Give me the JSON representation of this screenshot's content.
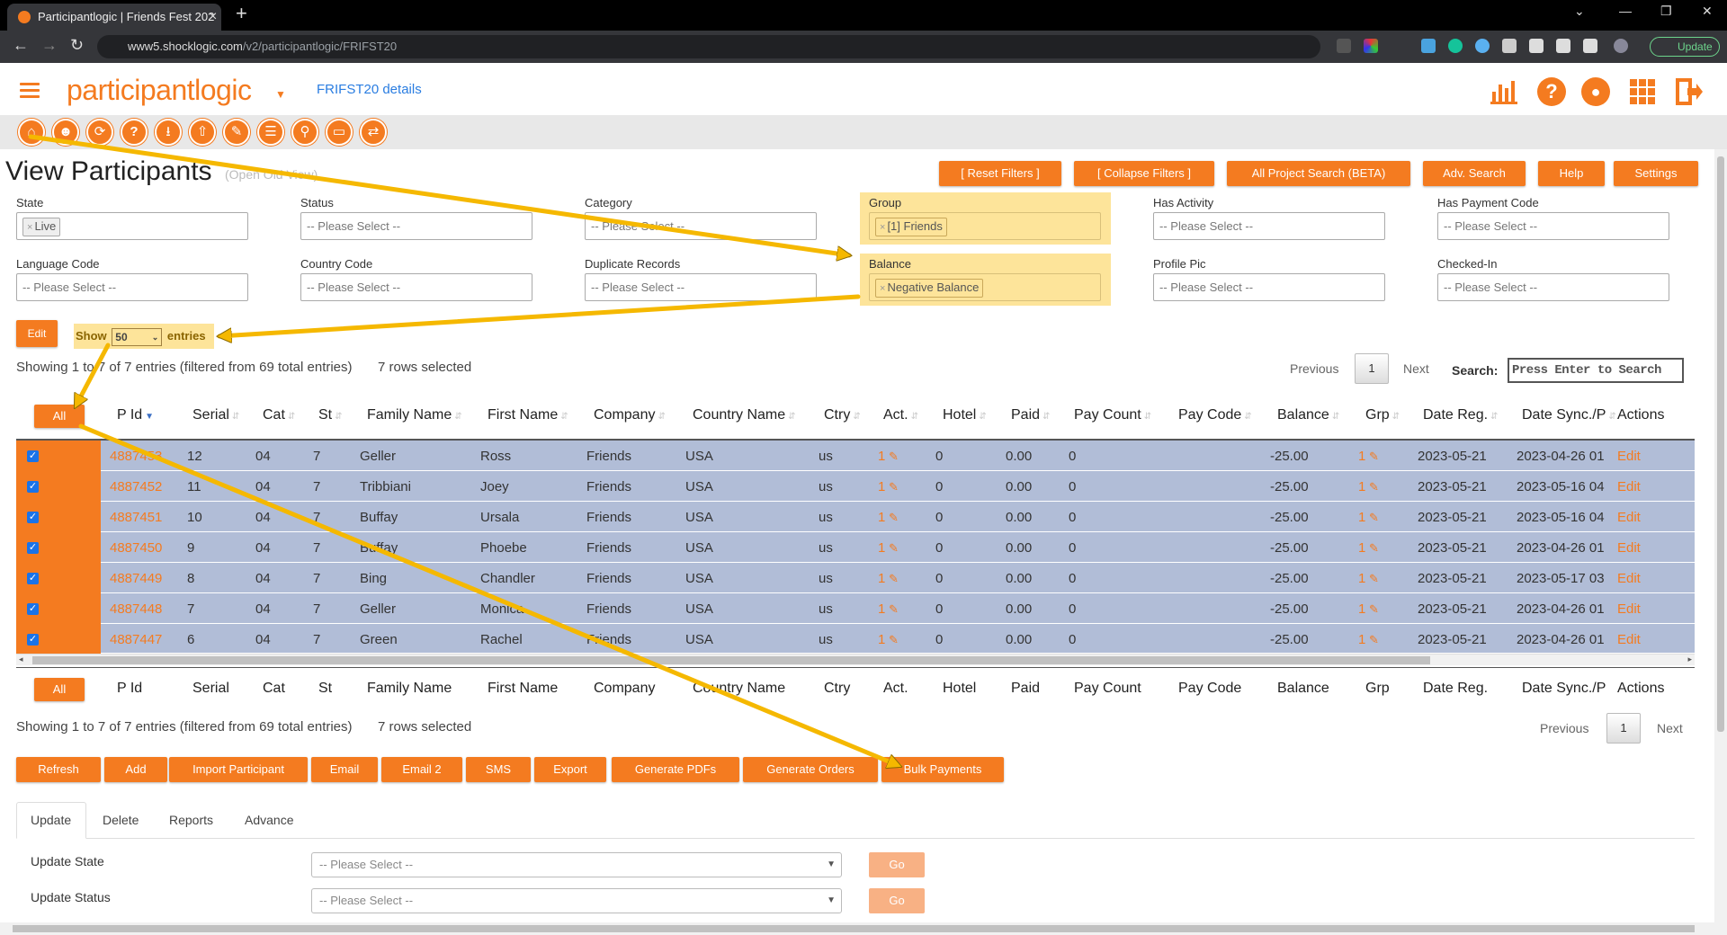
{
  "browser": {
    "tab_title": "Participantlogic | Friends Fest 202",
    "url_host": "www5.shocklogic.com",
    "url_path": "/v2/participantlogic/FRIFST20",
    "update_label": "Update"
  },
  "header": {
    "logo_text": "participantlogic",
    "project_link": "FRIFST20 details"
  },
  "page": {
    "title": "View Participants",
    "subtitle": "(Open Old View)"
  },
  "top_buttons": [
    "[ Reset Filters ]",
    "[ Collapse Filters ]",
    "All Project Search (BETA)",
    "Adv. Search",
    "Help",
    "Settings"
  ],
  "filters": [
    {
      "label": "State",
      "chip": "Live",
      "placeholder": ""
    },
    {
      "label": "Status",
      "chip": "",
      "placeholder": "-- Please Select --"
    },
    {
      "label": "Category",
      "chip": "",
      "placeholder": "-- Please Select --"
    },
    {
      "label": "Group",
      "chip": "[1] Friends",
      "placeholder": ""
    },
    {
      "label": "Has Activity",
      "chip": "",
      "placeholder": "-- Please Select --"
    },
    {
      "label": "Has Payment Code",
      "chip": "",
      "placeholder": "-- Please Select --"
    },
    {
      "label": "Language Code",
      "chip": "",
      "placeholder": "-- Please Select --"
    },
    {
      "label": "Country Code",
      "chip": "",
      "placeholder": "-- Please Select --"
    },
    {
      "label": "Duplicate Records",
      "chip": "",
      "placeholder": "-- Please Select --"
    },
    {
      "label": "Balance",
      "chip": "Negative Balance",
      "placeholder": ""
    },
    {
      "label": "Profile Pic",
      "chip": "",
      "placeholder": "-- Please Select --"
    },
    {
      "label": "Checked-In",
      "chip": "",
      "placeholder": "-- Please Select --"
    }
  ],
  "edit_label": "Edit",
  "show_entries": {
    "show": "Show",
    "value": "50",
    "entries": "entries"
  },
  "info_top": "Showing 1 to 7 of 7 entries (filtered from 69 total entries)",
  "rows_selected": "7 rows selected",
  "pager": {
    "previous": "Previous",
    "page": "1",
    "next": "Next"
  },
  "search": {
    "label": "Search:",
    "placeholder": "Press Enter to Search"
  },
  "all_label": "All",
  "columns": [
    "P Id",
    "Serial",
    "Cat",
    "St",
    "Family Name",
    "First Name",
    "Company",
    "Country Name",
    "Ctry",
    "Act.",
    "Hotel",
    "Paid",
    "Pay Count",
    "Pay Code",
    "Balance",
    "Grp",
    "Date Reg.",
    "Date Sync./P",
    "Actions"
  ],
  "rows": [
    {
      "pid": "4887453",
      "serial": "12",
      "cat": "04",
      "st": "7",
      "family": "Geller",
      "first": "Ross",
      "company": "Friends",
      "country": "USA",
      "ctry": "us",
      "act": "1",
      "hotel": "0",
      "paid": "0.00",
      "paycount": "0",
      "balance": "-25.00",
      "grp": "1",
      "datereg": "2023-05-21",
      "datesync": "2023-04-26 01",
      "action": "Edit"
    },
    {
      "pid": "4887452",
      "serial": "11",
      "cat": "04",
      "st": "7",
      "family": "Tribbiani",
      "first": "Joey",
      "company": "Friends",
      "country": "USA",
      "ctry": "us",
      "act": "1",
      "hotel": "0",
      "paid": "0.00",
      "paycount": "0",
      "balance": "-25.00",
      "grp": "1",
      "datereg": "2023-05-21",
      "datesync": "2023-05-16 04",
      "action": "Edit"
    },
    {
      "pid": "4887451",
      "serial": "10",
      "cat": "04",
      "st": "7",
      "family": "Buffay",
      "first": "Ursala",
      "company": "Friends",
      "country": "USA",
      "ctry": "us",
      "act": "1",
      "hotel": "0",
      "paid": "0.00",
      "paycount": "0",
      "balance": "-25.00",
      "grp": "1",
      "datereg": "2023-05-21",
      "datesync": "2023-05-16 04",
      "action": "Edit"
    },
    {
      "pid": "4887450",
      "serial": "9",
      "cat": "04",
      "st": "7",
      "family": "Buffay",
      "first": "Phoebe",
      "company": "Friends",
      "country": "USA",
      "ctry": "us",
      "act": "1",
      "hotel": "0",
      "paid": "0.00",
      "paycount": "0",
      "balance": "-25.00",
      "grp": "1",
      "datereg": "2023-05-21",
      "datesync": "2023-04-26 01",
      "action": "Edit"
    },
    {
      "pid": "4887449",
      "serial": "8",
      "cat": "04",
      "st": "7",
      "family": "Bing",
      "first": "Chandler",
      "company": "Friends",
      "country": "USA",
      "ctry": "us",
      "act": "1",
      "hotel": "0",
      "paid": "0.00",
      "paycount": "0",
      "balance": "-25.00",
      "grp": "1",
      "datereg": "2023-05-21",
      "datesync": "2023-05-17 03",
      "action": "Edit"
    },
    {
      "pid": "4887448",
      "serial": "7",
      "cat": "04",
      "st": "7",
      "family": "Geller",
      "first": "Monica",
      "company": "Friends",
      "country": "USA",
      "ctry": "us",
      "act": "1",
      "hotel": "0",
      "paid": "0.00",
      "paycount": "0",
      "balance": "-25.00",
      "grp": "1",
      "datereg": "2023-05-21",
      "datesync": "2023-04-26 01",
      "action": "Edit"
    },
    {
      "pid": "4887447",
      "serial": "6",
      "cat": "04",
      "st": "7",
      "family": "Green",
      "first": "Rachel",
      "company": "Friends",
      "country": "USA",
      "ctry": "us",
      "act": "1",
      "hotel": "0",
      "paid": "0.00",
      "paycount": "0",
      "balance": "-25.00",
      "grp": "1",
      "datereg": "2023-05-21",
      "datesync": "2023-04-26 01",
      "action": "Edit"
    }
  ],
  "info_bottom": "Showing 1 to 7 of 7 entries (filtered from 69 total entries)",
  "bottom_buttons": [
    "Refresh",
    "Add",
    "Import Participant",
    "Email",
    "Email 2",
    "SMS",
    "Export",
    "Generate PDFs",
    "Generate Orders",
    "Bulk Payments"
  ],
  "tabs": [
    "Update",
    "Delete",
    "Reports",
    "Advance"
  ],
  "update_form": [
    {
      "label": "Update State",
      "placeholder": "-- Please Select --",
      "go": "Go"
    },
    {
      "label": "Update Status",
      "placeholder": "-- Please Select --",
      "go": "Go"
    }
  ],
  "colors": {
    "accent": "#f47b20",
    "row_selected": "#b1bdd7",
    "highlight": "#fde49a",
    "arrow": "#f5b800"
  },
  "icons": {
    "toolbar": [
      "home-icon",
      "participants-icon",
      "sync-icon",
      "help-icon",
      "download-icon",
      "upload-icon",
      "attach-icon",
      "notes-icon",
      "search-icon",
      "hotel-icon",
      "shuffle-icon"
    ],
    "header": [
      "stats-icon",
      "help-icon",
      "user-icon",
      "apps-icon",
      "logout-icon"
    ]
  }
}
